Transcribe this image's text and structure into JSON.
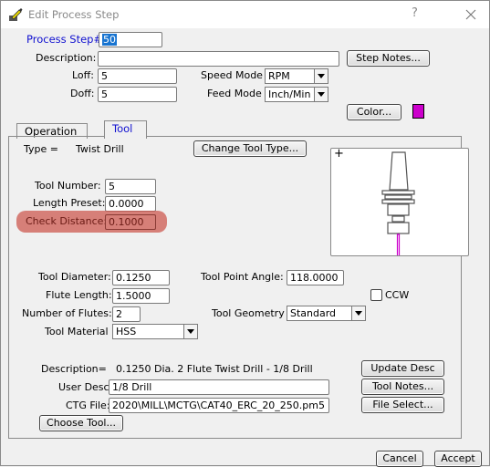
{
  "window": {
    "title": "Edit Process Step",
    "help_label": "?",
    "close_label": "✕"
  },
  "header": {
    "process_step_label": "Process Step#",
    "process_step_value": "50",
    "description_label": "Description:",
    "description_value": "",
    "step_notes_button": "Step Notes...",
    "loff_label": "Loff:",
    "loff_value": "5",
    "doff_label": "Doff:",
    "doff_value": "5",
    "speed_mode_label": "Speed Mode",
    "speed_mode_value": "RPM",
    "feed_mode_label": "Feed Mode",
    "feed_mode_value": "Inch/Min",
    "color_button": "Color...",
    "color_swatch": "#cc00cc"
  },
  "tabs": [
    {
      "label": "Operation",
      "active": false
    },
    {
      "label": "Tool",
      "active": true
    }
  ],
  "tool": {
    "type_label": "Type =",
    "type_value": "Twist Drill",
    "change_type_button": "Change Tool Type...",
    "tool_number_label": "Tool Number:",
    "tool_number_value": "5",
    "length_preset_label": "Length Preset:",
    "length_preset_value": "0.0000",
    "check_distance_label": "Check Distance:",
    "check_distance_value": "0.1000",
    "tool_diameter_label": "Tool Diameter:",
    "tool_diameter_value": "0.1250",
    "tool_point_angle_label": "Tool Point Angle:",
    "tool_point_angle_value": "118.0000",
    "flute_length_label": "Flute Length:",
    "flute_length_value": "1.5000",
    "ccw_label": "CCW",
    "ccw_checked": false,
    "num_flutes_label": "Number of Flutes:",
    "num_flutes_value": "2",
    "tool_geometry_label": "Tool Geometry",
    "tool_geometry_value": "Standard",
    "tool_material_label": "Tool Material",
    "tool_material_value": "HSS",
    "description_label": "Description=",
    "description_value": "0.1250 Dia. 2 Flute Twist Drill - 1/8 Drill",
    "update_desc_button": "Update Desc",
    "user_desc_label": "User Desc:",
    "user_desc_value": "1/8 Drill",
    "tool_notes_button": "Tool Notes...",
    "ctg_file_label": "CTG File:",
    "ctg_file_value": "2020\\MILL\\MCTG\\CAT40_ERC_20_250.pm5",
    "file_select_button": "File Select...",
    "choose_tool_button": "Choose Tool...",
    "preview_crosshair": "+",
    "tool_color": "#cc00cc"
  },
  "footer": {
    "cancel_button": "Cancel",
    "accept_button": "Accept"
  }
}
